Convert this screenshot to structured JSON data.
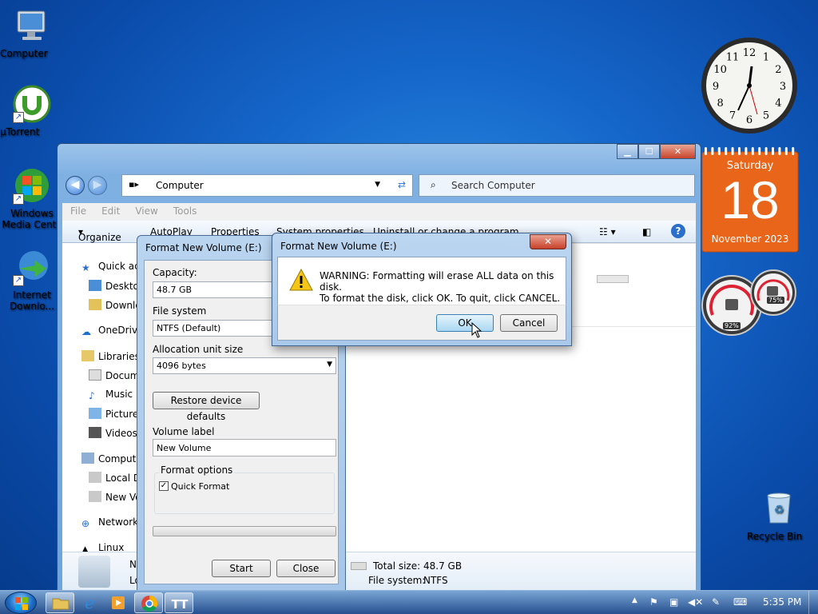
{
  "desktop_icons": [
    {
      "label": "Computer",
      "icon": "computer-icon"
    },
    {
      "label": "µTorrent",
      "icon": "utorrent-icon"
    },
    {
      "label": "Windows Media Cente",
      "icon": "windows-media-center-icon"
    },
    {
      "label": "Internet Downlo...",
      "icon": "internet-download-manager-icon"
    },
    {
      "label": "Recycle Bin",
      "icon": "recycle-bin-icon"
    }
  ],
  "explorer": {
    "address": "Computer",
    "search_placeholder": "Search Computer",
    "menu": [
      "File",
      "Edit",
      "View",
      "Tools"
    ],
    "commands": [
      "Organize",
      "AutoPlay",
      "Properties",
      "System properties",
      "Uninstall or change a program"
    ],
    "nav": [
      {
        "label": "Quick ac",
        "icon": "star-icon"
      },
      {
        "label": "Desktop",
        "icon": "desktop-folder-icon"
      },
      {
        "label": "Downlo",
        "icon": "downloads-folder-icon"
      },
      {
        "label": "OneDrive",
        "icon": "onedrive-icon"
      },
      {
        "label": "Libraries",
        "icon": "libraries-icon"
      },
      {
        "label": "Docum",
        "icon": "documents-icon"
      },
      {
        "label": "Music",
        "icon": "music-icon"
      },
      {
        "label": "Pictures",
        "icon": "pictures-icon"
      },
      {
        "label": "Videos",
        "icon": "videos-icon"
      },
      {
        "label": "Compute",
        "icon": "computer-icon"
      },
      {
        "label": "Local D",
        "icon": "local-disk-icon"
      },
      {
        "label": "New Vo",
        "icon": "drive-icon"
      },
      {
        "label": "Network",
        "icon": "network-icon"
      },
      {
        "label": "Linux",
        "icon": "linux-icon"
      }
    ],
    "details": {
      "name_partial": "N",
      "type_partial": "Lo",
      "total_size_label": "Total size:",
      "total_size": "48.7 GB",
      "file_system_label": "File system:",
      "file_system": "NTFS"
    }
  },
  "format_dialog": {
    "title": "Format New Volume (E:)",
    "capacity_label": "Capacity:",
    "capacity": "48.7 GB",
    "filesystem_label": "File system",
    "filesystem": "NTFS (Default)",
    "alloc_label": "Allocation unit size",
    "alloc": "4096 bytes",
    "restore_button": "Restore device defaults",
    "volume_label_label": "Volume label",
    "volume_label": "New Volume",
    "format_options_label": "Format options",
    "quick_format_label": "Quick Format",
    "quick_format_checked": true,
    "start_button": "Start",
    "close_button": "Close"
  },
  "warning_dialog": {
    "title": "Format New Volume (E:)",
    "line1": "WARNING: Formatting will erase ALL data on this disk.",
    "line2": "To format the disk, click OK. To quit, click CANCEL.",
    "ok_button": "OK",
    "cancel_button": "Cancel",
    "close_glyph": "✕"
  },
  "gadgets": {
    "calendar_day": "Saturday",
    "calendar_date": "18",
    "calendar_month": "November 2023",
    "clock_numbers": [
      "12",
      "1",
      "2",
      "3",
      "4",
      "5",
      "6",
      "7",
      "8",
      "9",
      "10",
      "11"
    ],
    "cpu_percent": "92%",
    "mem_percent": "75%"
  },
  "taskbar": {
    "time": "5:35 PM"
  },
  "colors": {
    "accent": "#3a7bd5",
    "calendar": "#e8651a",
    "close_red": "#c7412a"
  }
}
